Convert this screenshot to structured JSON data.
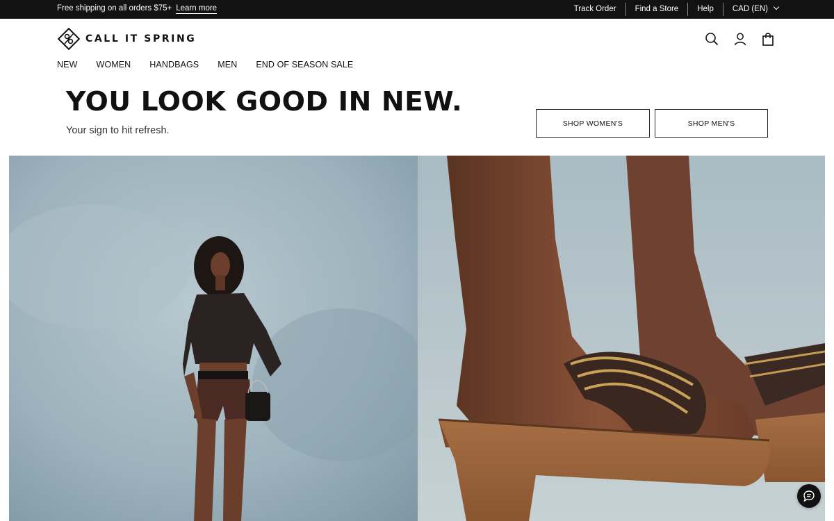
{
  "topbar": {
    "promo_text": "Free shipping on all orders $75+",
    "learn_more": "Learn more",
    "links": {
      "track_order": "Track Order",
      "find_store": "Find a Store",
      "help": "Help",
      "currency": "CAD (EN)"
    }
  },
  "header": {
    "brand": "CALL IT SPRING",
    "icons": [
      "search-icon",
      "account-icon",
      "shopping-bag-icon"
    ]
  },
  "nav": {
    "items": [
      "NEW",
      "WOMEN",
      "HANDBAGS",
      "MEN",
      "END OF SEASON SALE"
    ]
  },
  "hero": {
    "headline": "YOU LOOK GOOD IN NEW.",
    "subline": "Your sign to hit refresh.",
    "shop_womens": "SHOP WOMEN'S",
    "shop_mens": "SHOP MEN'S",
    "left_image": "woman-standing-photo",
    "right_image": "cork-platform-sandal-closeup-photo"
  },
  "chat": {
    "icon": "chat-icon"
  },
  "colors": {
    "topbar_bg": "#121212",
    "text": "#111111",
    "hero_backdrop": "#9fb4bd"
  }
}
